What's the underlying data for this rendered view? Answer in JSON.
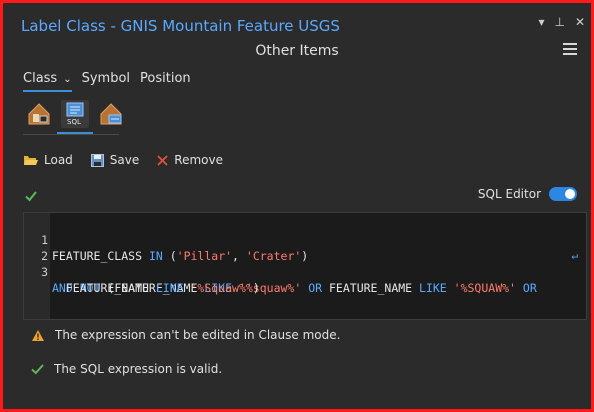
{
  "window": {
    "title": "Label Class - GNIS Mountain Feature USGS",
    "subtitle": "Other Items",
    "controls": {
      "dropdown_symbol": "▾",
      "pin_symbol": "⊥",
      "close_symbol": "✕"
    }
  },
  "tabs": [
    {
      "label": "Class",
      "active": true
    },
    {
      "label": "Symbol",
      "active": false
    },
    {
      "label": "Position",
      "active": false
    }
  ],
  "modes": [
    {
      "icon": "label-class-icon",
      "label": ""
    },
    {
      "icon": "sql-icon",
      "label": "SQL",
      "active": true
    },
    {
      "icon": "expression-icon",
      "label": ""
    }
  ],
  "toolbar": {
    "load_label": "Load",
    "save_label": "Save",
    "remove_label": "Remove"
  },
  "sql_editor": {
    "label": "SQL Editor",
    "enabled": true
  },
  "code": {
    "line_numbers": [
      "1",
      "2",
      "3"
    ],
    "line1": {
      "a": "FEATURE_CLASS ",
      "b": "IN",
      "c": " (",
      "d": "'Pillar'",
      "e": ", ",
      "f": "'Crater'",
      "g": ")"
    },
    "line3": {
      "a": "AND NOT",
      "b": " (FEATURE_NAME ",
      "c": "LIKE",
      "d": " ",
      "e": "'%squaw%'",
      "f": " ",
      "g": "OR",
      "h": " FEATURE_NAME ",
      "i": "LIKE",
      "j": " ",
      "k": "'%SQUAW%'",
      "l": " ",
      "m": "OR"
    },
    "line3_wrap": {
      "a": "  FEATURE_NAME ",
      "b": "LIKE",
      "c": " ",
      "d": "'%Squaw%'",
      "e": ")"
    }
  },
  "messages": {
    "warning": "The expression can't be edited in Clause mode.",
    "valid": "The SQL expression is valid."
  },
  "colors": {
    "accent": "#3d8ed8",
    "title": "#5aa9ff",
    "keyword": "#5aa9ff",
    "string": "#ff7b6b",
    "valid_check": "#5cb85c",
    "warning": "#f0a030",
    "frame_border": "#ff1a1a"
  }
}
